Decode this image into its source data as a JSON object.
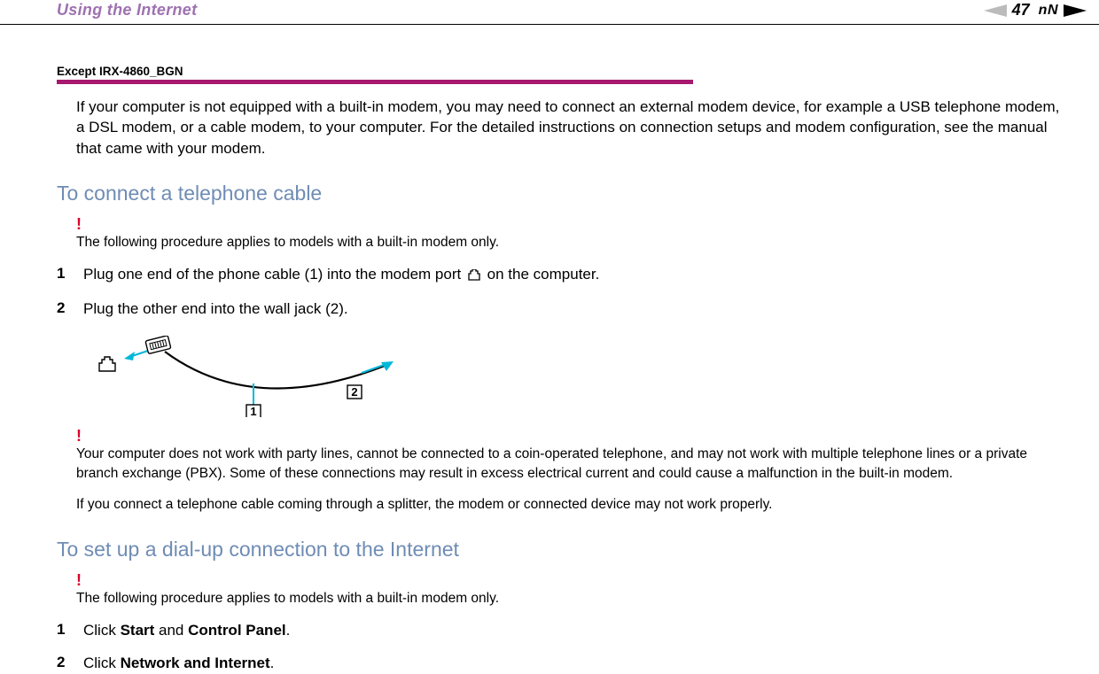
{
  "header": {
    "title": "Using the Internet",
    "page_number": "47",
    "nN": "nN"
  },
  "model_label": "Except IRX-4860_BGN",
  "intro_para": "If your computer is not equipped with a built-in modem, you may need to connect an external modem device, for example a USB telephone modem, a DSL modem, or a cable modem, to your computer. For the detailed instructions on connection setups and modem configuration, see the manual that came with your modem.",
  "section1": {
    "heading": "To connect a telephone cable",
    "warn1": "The following procedure applies to models with a built-in modem only.",
    "step1_pre": "Plug one end of the phone cable (1) into the modem port ",
    "step1_post": " on the computer.",
    "step2": "Plug the other end into the wall jack (2).",
    "diagram": {
      "label1": "1",
      "label2": "2"
    },
    "warn2": "Your computer does not work with party lines, cannot be connected to a coin-operated telephone, and may not work with multiple telephone lines or a private branch exchange (PBX). Some of these connections may result in excess electrical current and could cause a malfunction in the built-in modem.",
    "warn3": "If you connect a telephone cable coming through a splitter, the modem or connected device may not work properly."
  },
  "section2": {
    "heading": "To set up a dial-up connection to the Internet",
    "warn": "The following procedure applies to models with a built-in modem only.",
    "step1_pre": "Click ",
    "step1_b1": "Start",
    "step1_mid": " and ",
    "step1_b2": "Control Panel",
    "step1_post": ".",
    "step2_pre": "Click ",
    "step2_b1": "Network and Internet",
    "step2_post": "."
  },
  "nums": {
    "n1": "1",
    "n2": "2"
  },
  "bang": "!"
}
